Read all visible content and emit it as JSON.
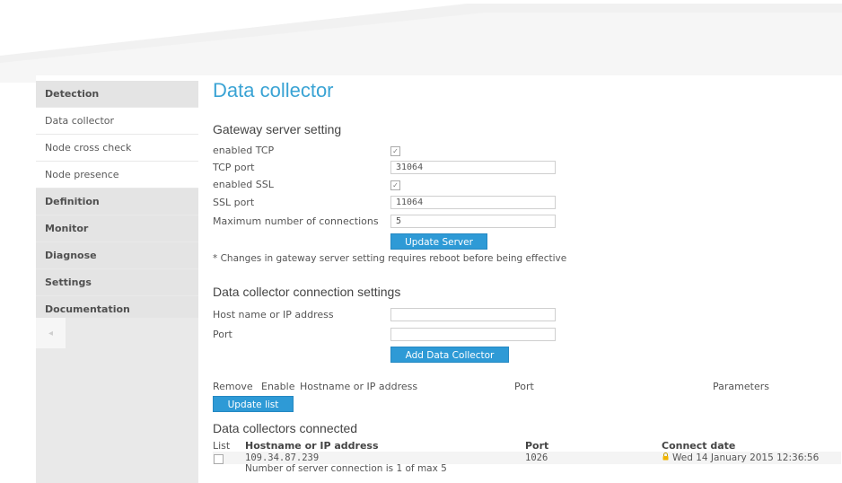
{
  "sidebar": {
    "items": [
      {
        "label": "Detection",
        "type": "head"
      },
      {
        "label": "Data collector",
        "type": "sub"
      },
      {
        "label": "Node cross check",
        "type": "sub"
      },
      {
        "label": "Node presence",
        "type": "sub"
      },
      {
        "label": "Definition",
        "type": "head"
      },
      {
        "label": "Monitor",
        "type": "head"
      },
      {
        "label": "Diagnose",
        "type": "head"
      },
      {
        "label": "Settings",
        "type": "head"
      },
      {
        "label": "Documentation",
        "type": "head"
      }
    ],
    "collapse_glyph": "◂"
  },
  "page": {
    "title": "Data collector",
    "gateway": {
      "heading": "Gateway server setting",
      "enabled_tcp_label": "enabled TCP",
      "tcp_port_label": "TCP port",
      "tcp_port_value": "31064",
      "enabled_ssl_label": "enabled SSL",
      "ssl_port_label": "SSL port",
      "ssl_port_value": "11064",
      "max_conn_label": "Maximum number of connections",
      "max_conn_value": "5",
      "update_button": "Update Server",
      "note": "* Changes in gateway server setting requires reboot before being effective",
      "check_glyph": "✓"
    },
    "connection": {
      "heading": "Data collector connection settings",
      "host_label": "Host name or IP address",
      "host_value": "",
      "port_label": "Port",
      "port_value": "",
      "add_button": "Add Data Collector"
    },
    "list": {
      "columns": [
        "Remove",
        "Enable",
        "Hostname or IP address",
        "Port",
        "Parameters"
      ],
      "update_button": "Update list"
    },
    "connected": {
      "heading": "Data collectors connected",
      "columns": [
        "List",
        "Hostname or IP address",
        "Port",
        "Connect date"
      ],
      "rows": [
        {
          "host": "109.34.87.239",
          "port": "1026",
          "date": "Wed 14 January 2015 12:36:56",
          "note": "Number of server connection is 1 of max 5"
        }
      ]
    }
  },
  "colors": {
    "accent": "#3aa3d4",
    "button": "#2e9ad6",
    "sidebar_head": "#e4e4e4"
  }
}
